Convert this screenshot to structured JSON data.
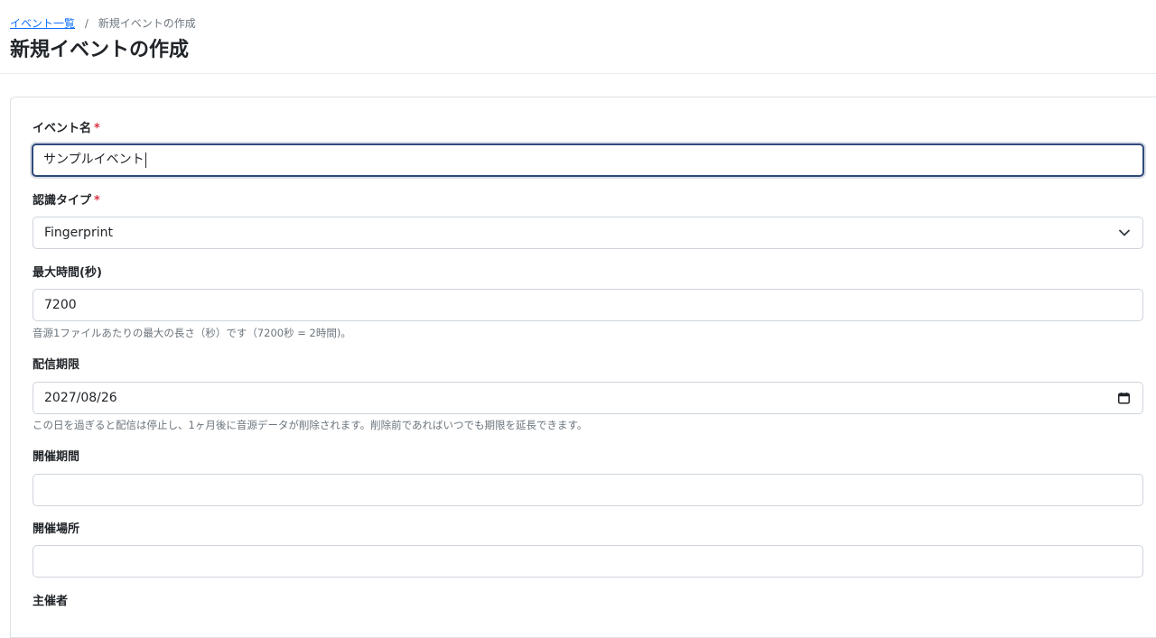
{
  "breadcrumb": {
    "parent": "イベント一覧",
    "separator": "/",
    "current": "新規イベントの作成"
  },
  "page": {
    "title": "新規イベントの作成"
  },
  "form": {
    "required_mark": "*",
    "event_name": {
      "label": "イベント名",
      "value": "サンプルイベント"
    },
    "recognition_type": {
      "label": "認識タイプ",
      "selected": "Fingerprint"
    },
    "max_duration": {
      "label": "最大時間(秒)",
      "value": "7200",
      "help": "音源1ファイルあたりの最大の長さ（秒）です（7200秒 = 2時間)。"
    },
    "delivery_deadline": {
      "label": "配信期限",
      "value": "2027/08/26",
      "help": "この日を過ぎると配信は停止し、1ヶ月後に音源データが削除されます。削除前であればいつでも期限を延長できます。"
    },
    "event_period": {
      "label": "開催期間",
      "value": ""
    },
    "venue": {
      "label": "開催場所",
      "value": ""
    },
    "organizer": {
      "label": "主催者"
    }
  },
  "icons": {
    "select": "chevron-down-icon",
    "date": "calendar-icon"
  },
  "colors": {
    "link": "#0d6efd",
    "required": "#dc3545",
    "focus_border": "#2f4a7a"
  }
}
